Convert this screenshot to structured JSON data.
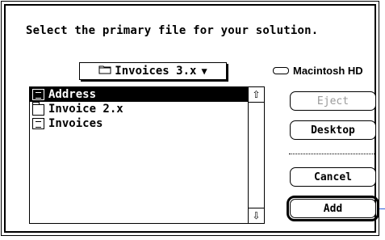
{
  "dialog": {
    "prompt": "Select the primary file for your solution.",
    "folder_popup": {
      "label": "Invoices 3.x",
      "icon": "folder-icon",
      "arrow": "▼"
    },
    "volume": {
      "label": "Macintosh HD",
      "icon": "hard-disk-icon"
    },
    "files": [
      {
        "name": "Address",
        "icon": "document-icon",
        "selected": true
      },
      {
        "name": "Invoice 2.x",
        "icon": "folder-icon",
        "selected": false
      },
      {
        "name": "Invoices",
        "icon": "document-icon",
        "selected": false
      }
    ],
    "scrollbar": {
      "up_glyph": "⇧",
      "down_glyph": "⇩"
    },
    "buttons": {
      "eject": "Eject",
      "desktop": "Desktop",
      "cancel": "Cancel",
      "add": "Add"
    },
    "accent_color": "#2b5bd8"
  }
}
